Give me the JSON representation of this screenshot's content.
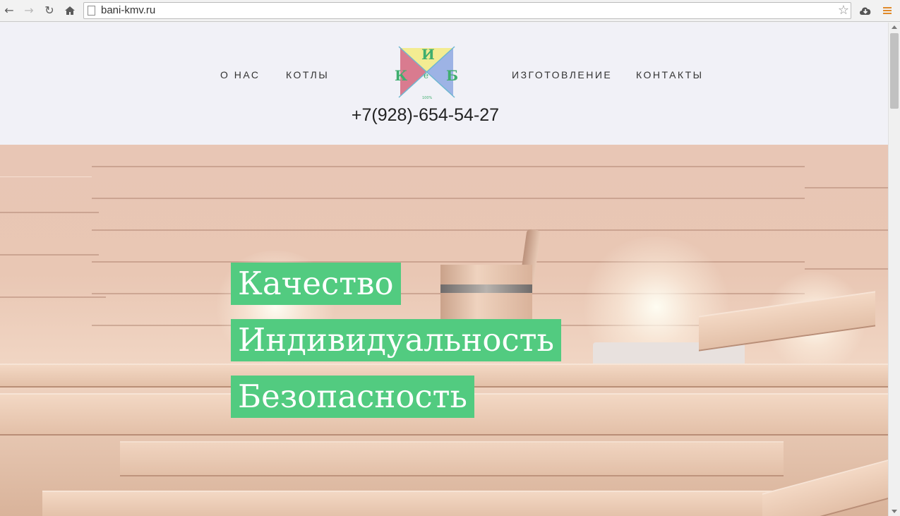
{
  "browser": {
    "url": "bani-kmv.ru"
  },
  "site": {
    "nav_left": [
      "О НАС",
      "КОТЛЫ"
    ],
    "nav_right": [
      "ИЗГОТОВЛЕНИЕ",
      "КОНТАКТЫ"
    ],
    "logo": {
      "letters": [
        "И",
        "К",
        "е",
        "Б"
      ],
      "small_text": "100%"
    },
    "phone": "+7(928)-654-54-27"
  },
  "hero": {
    "taglines": [
      " Качество",
      "Индивидуальность",
      "Безопасность"
    ],
    "accent_color": "#52cb80"
  }
}
